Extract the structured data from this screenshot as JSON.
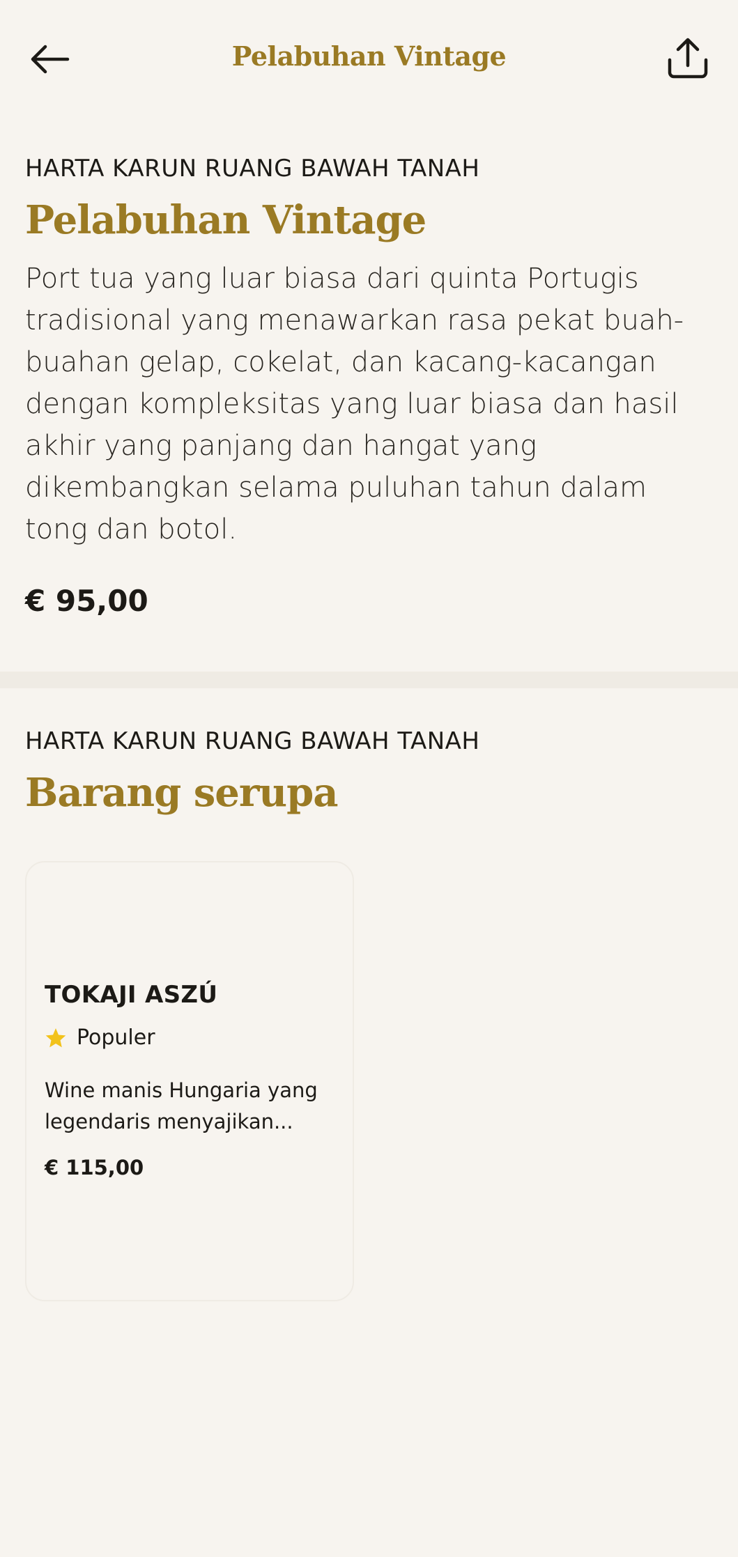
{
  "header": {
    "title": "Pelabuhan Vintage",
    "back_icon": "arrow-left-icon",
    "share_icon": "share-icon"
  },
  "product": {
    "category": "HARTA KARUN RUANG BAWAH TANAH",
    "title": "Pelabuhan Vintage",
    "description": "Port tua yang luar biasa dari quinta Portugis tradisional yang menawarkan rasa pekat buah-buahan gelap, cokelat, dan kacang-kacangan dengan kompleksitas yang luar biasa dan hasil akhir yang panjang dan hangat yang dikembangkan selama puluhan tahun dalam tong dan botol.",
    "price": "€ 95,00"
  },
  "similar": {
    "category": "HARTA KARUN RUANG BAWAH TANAH",
    "title": "Barang serupa",
    "items": [
      {
        "name": "TOKAJI ASZÚ",
        "badge": "Populer",
        "badge_icon": "star-icon",
        "description": "Wine manis Hungaria yang legendaris menyajikan...",
        "price": "€ 115,00"
      }
    ]
  },
  "colors": {
    "background": "#f7f4ef",
    "accent_gold": "#9a7a24",
    "star": "#f2c21b",
    "text": "#1c1a16"
  }
}
